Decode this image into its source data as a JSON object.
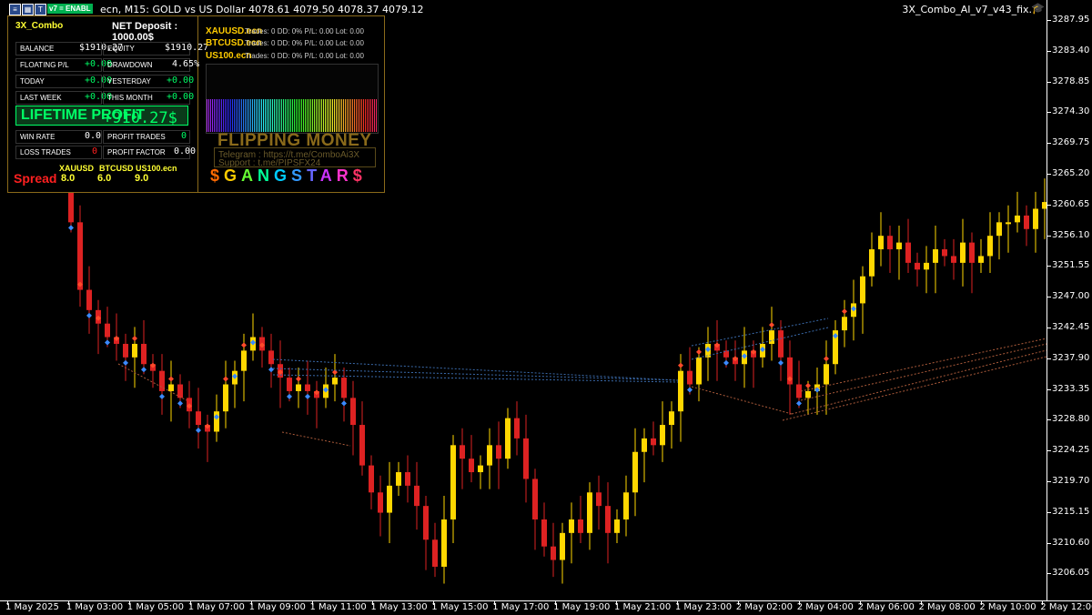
{
  "window": {
    "symbol_title": "ecn, M15:  GOLD vs US Dollar  4078.61 4079.50 4078.37 4079.12",
    "ea_name": "3X_Combo_AI_v7_v43_fix.",
    "enable_tag": "v7 = ENABL"
  },
  "price_axis": {
    "labels": [
      "3287.95",
      "3283.40",
      "3278.85",
      "3274.30",
      "3269.75",
      "3265.20",
      "3260.65",
      "3256.10",
      "3251.55",
      "3247.00",
      "3242.45",
      "3237.90",
      "3233.35",
      "3228.80",
      "3224.25",
      "3219.70",
      "3215.15",
      "3210.60",
      "3206.05"
    ]
  },
  "time_axis": {
    "labels": [
      "1 May 2025",
      "1 May 03:00",
      "1 May 05:00",
      "1 May 07:00",
      "1 May 09:00",
      "1 May 11:00",
      "1 May 13:00",
      "1 May 15:00",
      "1 May 17:00",
      "1 May 19:00",
      "1 May 21:00",
      "1 May 23:00",
      "2 May 02:00",
      "2 May 04:00",
      "2 May 06:00",
      "2 May 08:00",
      "2 May 10:00",
      "2 May 12:00"
    ]
  },
  "dashboard": {
    "header": "3X_Combo",
    "net_deposit": "NET Deposit : 1000.00$",
    "balance_label": "BALANCE",
    "balance_value": "$1910.27",
    "equity_label": "EQUITY",
    "equity_value": "$1910.27",
    "floating_label": "FLOATING P/L",
    "floating_value": "+0.00",
    "drawdown_label": "DRAWDOWN",
    "drawdown_value": "4.65%",
    "today_label": "TODAY",
    "today_value": "+0.00",
    "yesterday_label": "YESTERDAY",
    "yesterday_value": "+0.00",
    "lastweek_label": "LAST WEEK",
    "lastweek_value": "+0.00",
    "thismonth_label": "THIS MONTH",
    "thismonth_value": "+0.00",
    "lifetime_label": "LIFETIME PROFIT",
    "lifetime_value": "+910.27$",
    "winrate_label": "WIN RATE",
    "winrate_value": "0.0",
    "profit_trades_label": "PROFIT TRADES",
    "profit_trades_value": "0",
    "loss_trades_label": "LOSS TRADES",
    "loss_trades_value": "0",
    "profit_factor_label": "PROFIT FACTOR",
    "profit_factor_value": "0.00",
    "spread_label": "Spread",
    "spread_symbols": [
      "XAUUSD",
      "BTCUSD",
      "US100.ecn"
    ],
    "spread_values": [
      "8.0",
      "6.0",
      "9.0"
    ]
  },
  "symbols_panel": {
    "rows": [
      {
        "symbol": "XAUUSD.ecn",
        "data": "Trades: 0  DD: 0%  P/L: 0.00   Lot: 0.00"
      },
      {
        "symbol": "BTCUSD.ecn",
        "data": "Trades: 0  DD: 0%  P/L: 0.00   Lot: 0.00"
      },
      {
        "symbol": "US100.ecn",
        "data": "Trades: 0  DD: 0%  P/L: 0.00   Lot: 0.00"
      }
    ],
    "flipping": "FLIPPING MONEY",
    "telegram": "Telegram : https://t.me/ComboAi3X",
    "support": "Support : t.me/PIPSFX24",
    "gangstar": [
      "$",
      "G",
      "A",
      "N",
      "G",
      "S",
      "T",
      "A",
      "R",
      "$"
    ],
    "gangstar_colors": [
      "#ff6a00",
      "#ffcc00",
      "#66ff33",
      "#00ff99",
      "#00ccff",
      "#3399ff",
      "#6666ff",
      "#cc33ff",
      "#ff33cc",
      "#ff3366"
    ]
  },
  "colors": {
    "bull": "#ffd700",
    "bear": "#dd2222",
    "marker_red": "#ff4a2a",
    "marker_blue": "#3a8aff"
  },
  "chart_data": {
    "type": "candlestick",
    "symbol": "GOLD vs US Dollar",
    "timeframe": "M15",
    "ylim": [
      3203.0,
      3290.0
    ],
    "series_summary": "Gold price chart from 1 May 2025 to 2 May 12:00; drop from ~3265 to ~3206, recovery to ~3261"
  }
}
